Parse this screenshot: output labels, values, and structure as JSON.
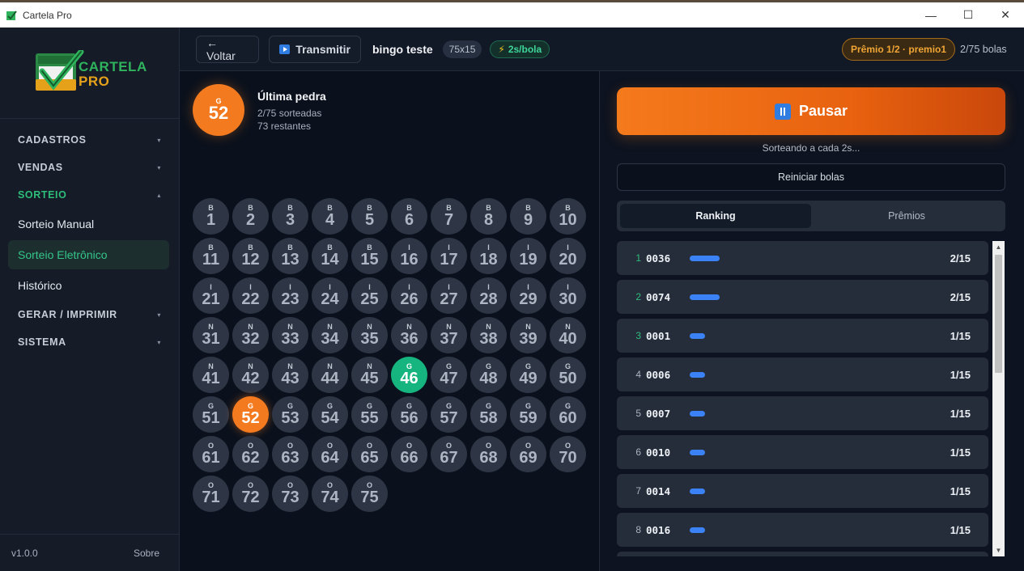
{
  "window": {
    "title": "Cartela Pro",
    "minimize": "—",
    "maximize": "☐",
    "close": "✕"
  },
  "sidebar": {
    "logo_line1": "CARTELA",
    "logo_line2": "PRO",
    "sections": [
      {
        "label": "CADASTROS",
        "caret": "▾"
      },
      {
        "label": "VENDAS",
        "caret": "▾"
      },
      {
        "label": "SORTEIO",
        "caret": "▴"
      },
      {
        "label": "GERAR / IMPRIMIR",
        "caret": "▾"
      },
      {
        "label": "SISTEMA",
        "caret": "▾"
      }
    ],
    "sorteio_items": [
      "Sorteio Manual",
      "Sorteio Eletrônico",
      "Histórico"
    ],
    "version": "v1.0.0",
    "about": "Sobre"
  },
  "topbar": {
    "back_label": "← Voltar",
    "transmit_label": "Transmitir",
    "game_name": "bingo teste",
    "size": "75x15",
    "speed": "2s/bola",
    "speed_icon": "⚡",
    "prize": "Prêmio 1/2 · premio1",
    "ball_count": "2/75 bolas"
  },
  "last_ball": {
    "letter": "G",
    "number": "52",
    "heading": "Última pedra",
    "drawn_text": "2/75 sorteadas",
    "remaining_text": "73 restantes"
  },
  "board": {
    "letters": [
      "B",
      "I",
      "N",
      "G",
      "O"
    ],
    "total": 75,
    "drawn": [
      46
    ],
    "current": 52
  },
  "controls": {
    "pause_label": "Pausar",
    "status": "Sorteando a cada 2s...",
    "reset_label": "Reiniciar bolas"
  },
  "tabs": {
    "ranking": "Ranking",
    "prizes": "Prêmios"
  },
  "ranking": [
    {
      "pos": "1",
      "card": "0036",
      "score": "2/15",
      "progress": 0.1333
    },
    {
      "pos": "2",
      "card": "0074",
      "score": "2/15",
      "progress": 0.1333
    },
    {
      "pos": "3",
      "card": "0001",
      "score": "1/15",
      "progress": 0.0667
    },
    {
      "pos": "4",
      "card": "0006",
      "score": "1/15",
      "progress": 0.0667
    },
    {
      "pos": "5",
      "card": "0007",
      "score": "1/15",
      "progress": 0.0667
    },
    {
      "pos": "6",
      "card": "0010",
      "score": "1/15",
      "progress": 0.0667
    },
    {
      "pos": "7",
      "card": "0014",
      "score": "1/15",
      "progress": 0.0667
    },
    {
      "pos": "8",
      "card": "0016",
      "score": "1/15",
      "progress": 0.0667
    }
  ],
  "colors": {
    "accent_orange": "#f47a1f",
    "drawn_green": "#16b47f",
    "progress_blue": "#3b82f6",
    "active_nav": "#34c68a"
  }
}
